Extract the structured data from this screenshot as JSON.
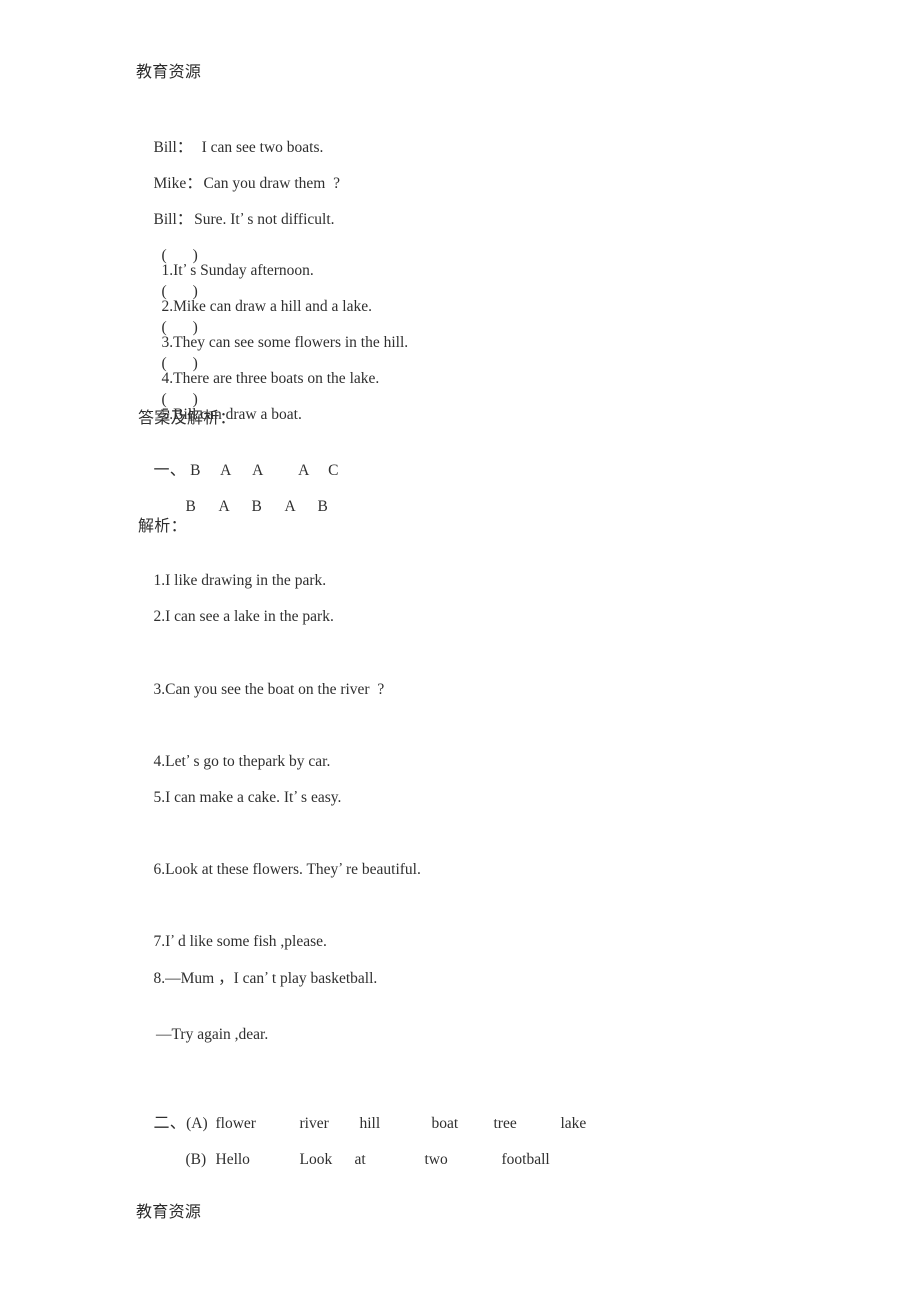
{
  "document": {
    "watermark_header": "教育资源",
    "watermark_footer": "教育资源"
  },
  "dialogue": [
    {
      "speaker": "Bill",
      "colon": "：",
      "text": "　I can see two boats."
    },
    {
      "speaker": "Mike",
      "colon": "：",
      "text": "Can you draw them  ?"
    },
    {
      "speaker": "Bill",
      "colon": "：",
      "text": "Sure. It",
      "apostrophe": "’",
      "text2": "s not difficult."
    }
  ],
  "true_false": {
    "paren_open": "(",
    "paren_close": ")",
    "items": [
      {
        "number": "1.",
        "text": "It",
        "apostrophe": "’",
        "text2": "s Sunday afternoon."
      },
      {
        "number": "2.",
        "text": "Mike can draw a hill and a lake.",
        "apostrophe": "",
        "text2": ""
      },
      {
        "number": "3.",
        "text": "They can see some flowers in the hill.",
        "apostrophe": "",
        "text2": ""
      },
      {
        "number": "4.",
        "text": "There are three boats on the lake.",
        "apostrophe": "",
        "text2": ""
      },
      {
        "number": "5.",
        "text": "Bill can draw a boat.",
        "apostrophe": "",
        "text2": ""
      }
    ]
  },
  "answer_section": {
    "heading": "答案及解析：",
    "part_one_marker": "一、",
    "row1": [
      "B",
      "A",
      "A",
      "A",
      "C"
    ],
    "row2": [
      "B",
      "A",
      "B",
      "A",
      "B"
    ],
    "analysis_heading": "解析："
  },
  "analysis": [
    {
      "number": "1.",
      "text": "I like drawing in the park.",
      "apostrophe": "",
      "text2": ""
    },
    {
      "number": "2.",
      "text": "I can see a lake in the park.",
      "apostrophe": "",
      "text2": ""
    },
    {
      "number": "3.",
      "text": "Can you see the boat on the river  ?",
      "apostrophe": "",
      "text2": ""
    },
    {
      "number": "4.",
      "text": "Let",
      "apostrophe": "’",
      "text2": "s go to thepark by car."
    },
    {
      "number": "5.",
      "text": "I can make a cake. It",
      "apostrophe": "’",
      "text2": "s easy."
    },
    {
      "number": "6.",
      "text": "Look at these flowers. They",
      "apostrophe": "’",
      "text2": "re beautiful."
    },
    {
      "number": "7.",
      "text": "I",
      "apostrophe": "’",
      "text2": "d like some fish ,please."
    },
    {
      "number": "8.",
      "text": "—Mum ，I can",
      "apostrophe": "’",
      "text2": "t play basketball."
    }
  ],
  "analysis_reply": "—Try again ,dear.",
  "vocabulary": {
    "part_two_marker": "二、",
    "group_a_label": "(A)",
    "group_a_words": [
      "flower",
      "river",
      "hill",
      "boat",
      "tree",
      "lake"
    ],
    "group_b_label": "(B)",
    "group_b_words": [
      "Hello",
      "Look",
      "at",
      "two",
      "football"
    ]
  }
}
